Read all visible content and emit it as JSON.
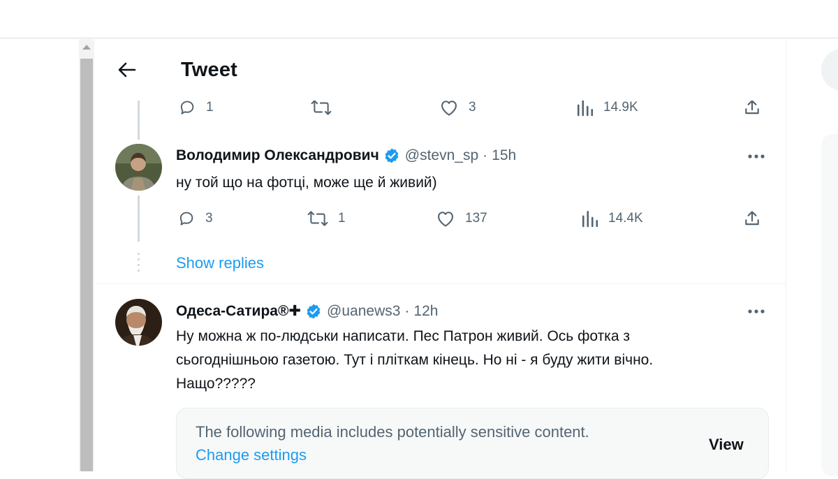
{
  "header": {
    "title": "Tweet"
  },
  "icons": {
    "back": "arrow-left-icon",
    "reply": "reply-bubble-icon",
    "retweet": "retweet-icon",
    "like": "heart-icon",
    "views": "bar-chart-icon",
    "share": "share-upload-icon",
    "more": "more-dots-icon",
    "verified": "verified-badge-icon"
  },
  "colors": {
    "accent": "#1d9bf0",
    "text": "#0f1419",
    "muted": "#536471"
  },
  "prev_tweet_actions": {
    "replies": "1",
    "retweets": "",
    "likes": "3",
    "views": "14.9K"
  },
  "tweet1": {
    "name": "Володимир Олександрович",
    "handle": "@stevn_sp",
    "sep": "·",
    "time": "15h",
    "text": "ну той що на фотці, може ще й живий)",
    "actions": {
      "replies": "3",
      "retweets": "1",
      "likes": "137",
      "views": "14.4K"
    }
  },
  "show_replies": "Show replies",
  "tweet2": {
    "name": "Одеса-Сатира®✚",
    "handle": "@uanews3",
    "sep": "·",
    "time": "12h",
    "lines": [
      "Ну можна ж по-людськи написати. Пес Патрон живий. Ось фотка з",
      "сьогоднішньою газетою. Тут і пліткам кінець. Но ні - я буду жити вічно.",
      "Нащо?????"
    ]
  },
  "sensitive": {
    "text": "The following media includes potentially sensitive content.",
    "link": "Change settings",
    "button": "View"
  }
}
